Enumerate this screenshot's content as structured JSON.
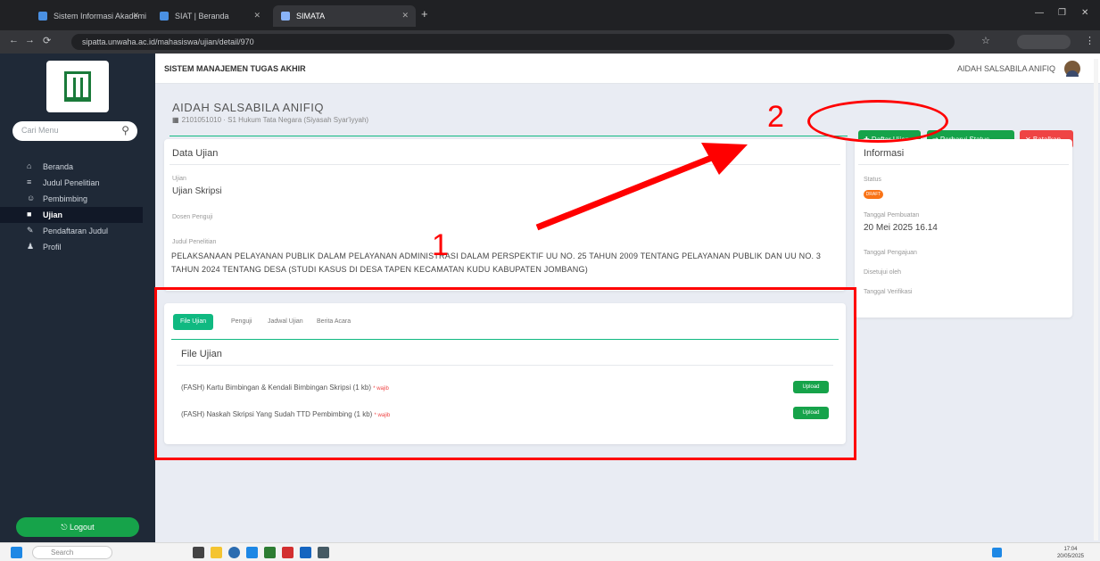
{
  "browser": {
    "tabs": [
      {
        "label": "Sistem Informasi Akademik"
      },
      {
        "label": "SIAT | Beranda"
      },
      {
        "label": "SIMATA"
      }
    ],
    "new_tab": "+",
    "url": "sipatta.unwaha.ac.id/mahasiswa/ujian/detail/970"
  },
  "sidebar": {
    "search_placeholder": "Cari Menu",
    "items": [
      {
        "label": "Beranda",
        "icon": "home-icon",
        "glyph": "⌂"
      },
      {
        "label": "Judul Penelitian",
        "icon": "document-icon",
        "glyph": "≡"
      },
      {
        "label": "Pembimbing",
        "icon": "people-icon",
        "glyph": "☺"
      },
      {
        "label": "Ujian",
        "icon": "book-icon",
        "glyph": "■"
      },
      {
        "label": "Pendaftaran Judul",
        "icon": "form-icon",
        "glyph": "✎"
      },
      {
        "label": "Profil",
        "icon": "user-icon",
        "glyph": "♟"
      }
    ],
    "logout": "⎋ Logout"
  },
  "header": {
    "app_title": "SISTEM MANAJEMEN TUGAS AKHIR",
    "user_name": "AIDAH SALSABILA ANIFIQ"
  },
  "profile": {
    "name": "AIDAH SALSABILA ANIFIQ",
    "sub": "2101051010 · S1 Hukum Tata Negara (Siyasah Syar'iyyah)"
  },
  "buttons": {
    "daftar_ujian": "✚ Daftar Ujian",
    "second": "⇄ Perbarui Status",
    "batal": "✕ Batalkan"
  },
  "data_ujian": {
    "title": "Data Ujian",
    "ujian_label": "Ujian",
    "ujian_value": "Ujian Skripsi",
    "dosen_label": "Dosen Penguji",
    "judul_label": "Judul Penelitian",
    "judul_value": "PELAKSANAAN PELAYANAN PUBLIK DALAM PELAYANAN ADMINISTRASI DALAM PERSPEKTIF UU NO. 25 TAHUN 2009 TENTANG PELAYANAN PUBLIK DAN UU NO. 3 TAHUN 2024 TENTANG DESA (STUDI KASUS DI DESA TAPEN KECAMATAN KUDU KABUPATEN JOMBANG)"
  },
  "informasi": {
    "title": "Informasi",
    "status_label": "Status",
    "status_value": "DRAFT",
    "tgl_pembuatan_label": "Tanggal Pembuatan",
    "tgl_pembuatan_value": "20 Mei 2025 16.14",
    "tgl_pengajuan_label": "Tanggal Pengajuan",
    "disetujui_label": "Disetujui oleh",
    "tgl_verifikasi_label": "Tanggal Verifikasi"
  },
  "tabs": [
    {
      "label": "File Ujian"
    },
    {
      "label": "Penguji"
    },
    {
      "label": "Jadwal Ujian"
    },
    {
      "label": "Berita Acara"
    }
  ],
  "files": {
    "title": "File Ujian",
    "rows": [
      {
        "label": "(FASH) Kartu Bimbingan & Kendali Bimbingan Skripsi (1 kb)",
        "req": "* wajib",
        "action": "Upload"
      },
      {
        "label": "(FASH) Naskah Skripsi Yang Sudah TTD Pembimbing (1 kb)",
        "req": "* wajib",
        "action": "Upload"
      }
    ]
  },
  "annotations": {
    "one": "1",
    "two": "2"
  },
  "taskbar": {
    "search": "Search",
    "time": "17:04",
    "date": "20/05/2025"
  },
  "colors": {
    "sidebar": "#1f2937",
    "green": "#16a34a",
    "red": "#ef4444",
    "annotation": "#ff0000"
  }
}
